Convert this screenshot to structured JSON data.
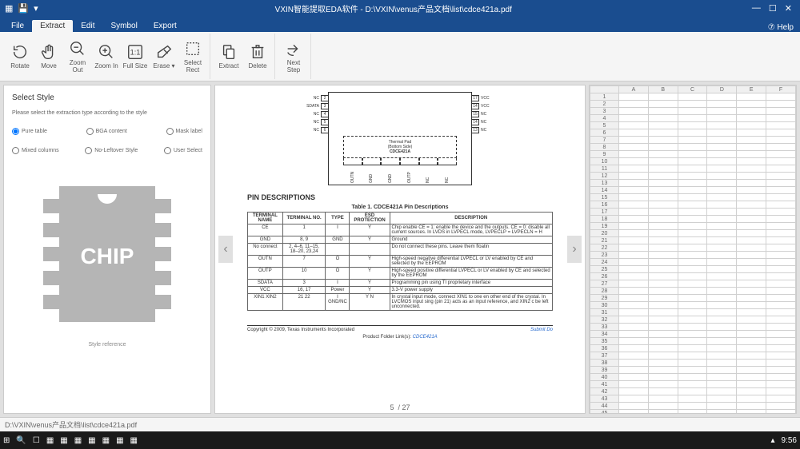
{
  "titlebar": {
    "title": "VXIN智能提取EDA软件 - D:\\VXIN\\venus产品文档\\list\\cdce421a.pdf"
  },
  "tabs": [
    "File",
    "Extract",
    "Edit",
    "Symbol",
    "Export"
  ],
  "activeTab": 1,
  "help": "⑦ Help",
  "ribbon": {
    "rotate": "Rotate",
    "move": "Move",
    "zoomOut": "Zoom\nOut",
    "zoomIn": "Zoom\nIn",
    "fullSize": "Full\nSize",
    "erase": "Erase\n▾",
    "selectRect": "Select\nRect",
    "extract": "Extract",
    "delete": "Delete",
    "nextStep": "Next\nStep"
  },
  "left": {
    "heading": "Select Style",
    "hint": "Please select the extraction type according to the style",
    "radios": {
      "r1": "Pure table",
      "r2": "BGA content",
      "r3": "Mask label",
      "r4": "Mixed columns",
      "r5": "No-Leftover Style",
      "r6": "User Select"
    },
    "chipLabel": "CHIP",
    "styleTxt": "Style reference"
  },
  "doc": {
    "pkg": {
      "left": [
        {
          "name": "NC",
          "num": "2",
          "rnum": "17",
          "rname": "VCC"
        },
        {
          "name": "SDATA",
          "num": "3",
          "rnum": "14",
          "rname": "VCC"
        },
        {
          "name": "NC",
          "num": "4",
          "rnum": "15",
          "rname": "NC"
        },
        {
          "name": "NC",
          "num": "5",
          "rnum": "14",
          "rname": "NC"
        },
        {
          "name": "NC",
          "num": "6",
          "rnum": "13",
          "rname": "NC"
        }
      ],
      "tp1": "Thermal Pad",
      "tp2": "(Bottom Side)",
      "tp3": "CDCE421A",
      "bottomNums": [
        "7",
        "8",
        "9",
        "10",
        "11",
        "12"
      ],
      "bottomLabels": [
        "OUTN",
        "GND",
        "GND",
        "OUTP",
        "NC",
        "NC"
      ]
    },
    "sectionHeading": "PIN DESCRIPTIONS",
    "tableCaption": "Table 1. CDCE421A Pin Descriptions",
    "table": {
      "headers": [
        "TERMINAL\nNAME",
        "TERMINAL\nNO.",
        "TYPE",
        "ESD\nPROTECTION",
        "DESCRIPTION"
      ],
      "rows": [
        [
          "CE",
          "1",
          "I",
          "Y",
          "Chip enable\nCE = 1: enable the device and the outputs.\nCE = 0: disable all current sources. In LVDS\nin LVPECL mode, LVPECLP = LVPECLN = H"
        ],
        [
          "GND",
          "8, 9",
          "GND",
          "Y",
          "Ground"
        ],
        [
          "No connect",
          "2, 4–6,\n11–15,\n18–20, 23,24",
          "",
          "",
          "Do not connect these pins. Leave them floatin"
        ],
        [
          "OUTN",
          "7",
          "O",
          "Y",
          "High-speed negative differential LVPECL or LV\nenabled by CE and selected by the EEPROM "
        ],
        [
          "OUTP",
          "10",
          "O",
          "Y",
          "High-speed positive differential LVPECL or LV\nenabled by CE and selected by the EEPROM "
        ],
        [
          "SDATA",
          "3",
          "I",
          "Y",
          "Programming pin using TI proprietary interface"
        ],
        [
          "VCC",
          "16, 17",
          "Power",
          "Y",
          "3.3-V power supply"
        ],
        [
          "XIN1\nXIN2",
          "21\n22",
          "I\nGND/NC",
          "Y\nN",
          "In crystal input mode, connect XIN1 to one en\nother end of the crystal. In LVCMOS input sing\n(pin 21) acts as an input reference, and XIN2 c\nbe left unconnected."
        ]
      ]
    },
    "copyright": "Copyright © 2009, Texas Instruments Incorporated",
    "submit": "Submit Do",
    "pfl": "Product Folder Link(s): ",
    "pflLink": "CDCE421A",
    "pageNum": "5",
    "pageTotal": "/ 27"
  },
  "sheet": {
    "cols": [
      "A",
      "B",
      "C",
      "D",
      "E",
      "F"
    ],
    "rowCount": 47
  },
  "statusbar": "D:\\VXIN\\venus产品文档\\list\\cdce421a.pdf",
  "taskbar": {
    "time": "9:56"
  }
}
